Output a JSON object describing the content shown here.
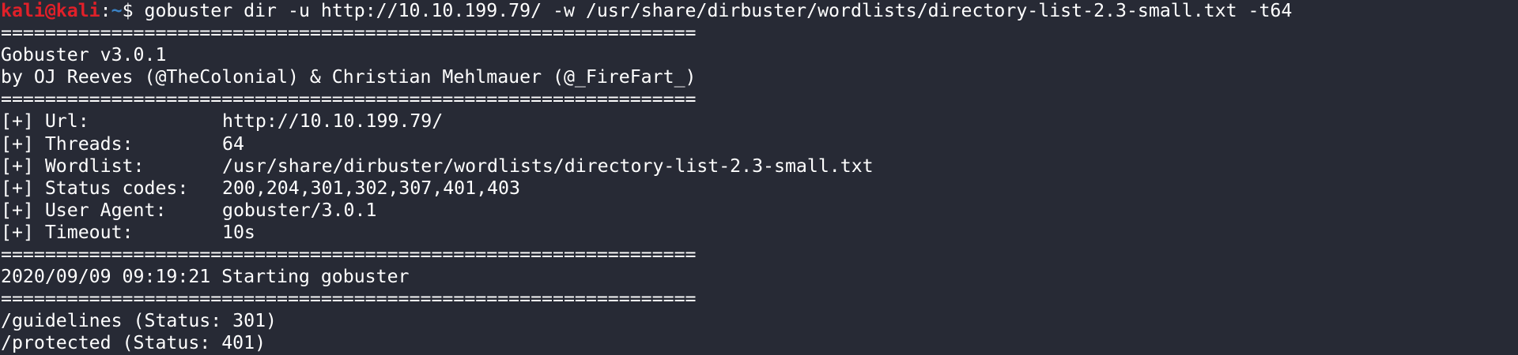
{
  "prompt": {
    "user": "kali@kali",
    "separator": ":",
    "path": "~",
    "symbol": "$ ",
    "command": "gobuster dir -u http://10.10.199.79/ -w /usr/share/dirbuster/wordlists/directory-list-2.3-small.txt -t64"
  },
  "divider": "===============================================================",
  "banner": {
    "title": "Gobuster v3.0.1",
    "authors": "by OJ Reeves (@TheColonial) & Christian Mehlmauer (@_FireFart_)"
  },
  "config": [
    {
      "label": "[+] Url:",
      "value": "http://10.10.199.79/"
    },
    {
      "label": "[+] Threads:",
      "value": "64"
    },
    {
      "label": "[+] Wordlist:",
      "value": "/usr/share/dirbuster/wordlists/directory-list-2.3-small.txt"
    },
    {
      "label": "[+] Status codes:",
      "value": "200,204,301,302,307,401,403"
    },
    {
      "label": "[+] User Agent:",
      "value": "gobuster/3.0.1"
    },
    {
      "label": "[+] Timeout:",
      "value": "10s"
    }
  ],
  "start_message": "2020/09/09 09:19:21 Starting gobuster",
  "results": [
    "/guidelines (Status: 301)",
    "/protected (Status: 401)"
  ]
}
